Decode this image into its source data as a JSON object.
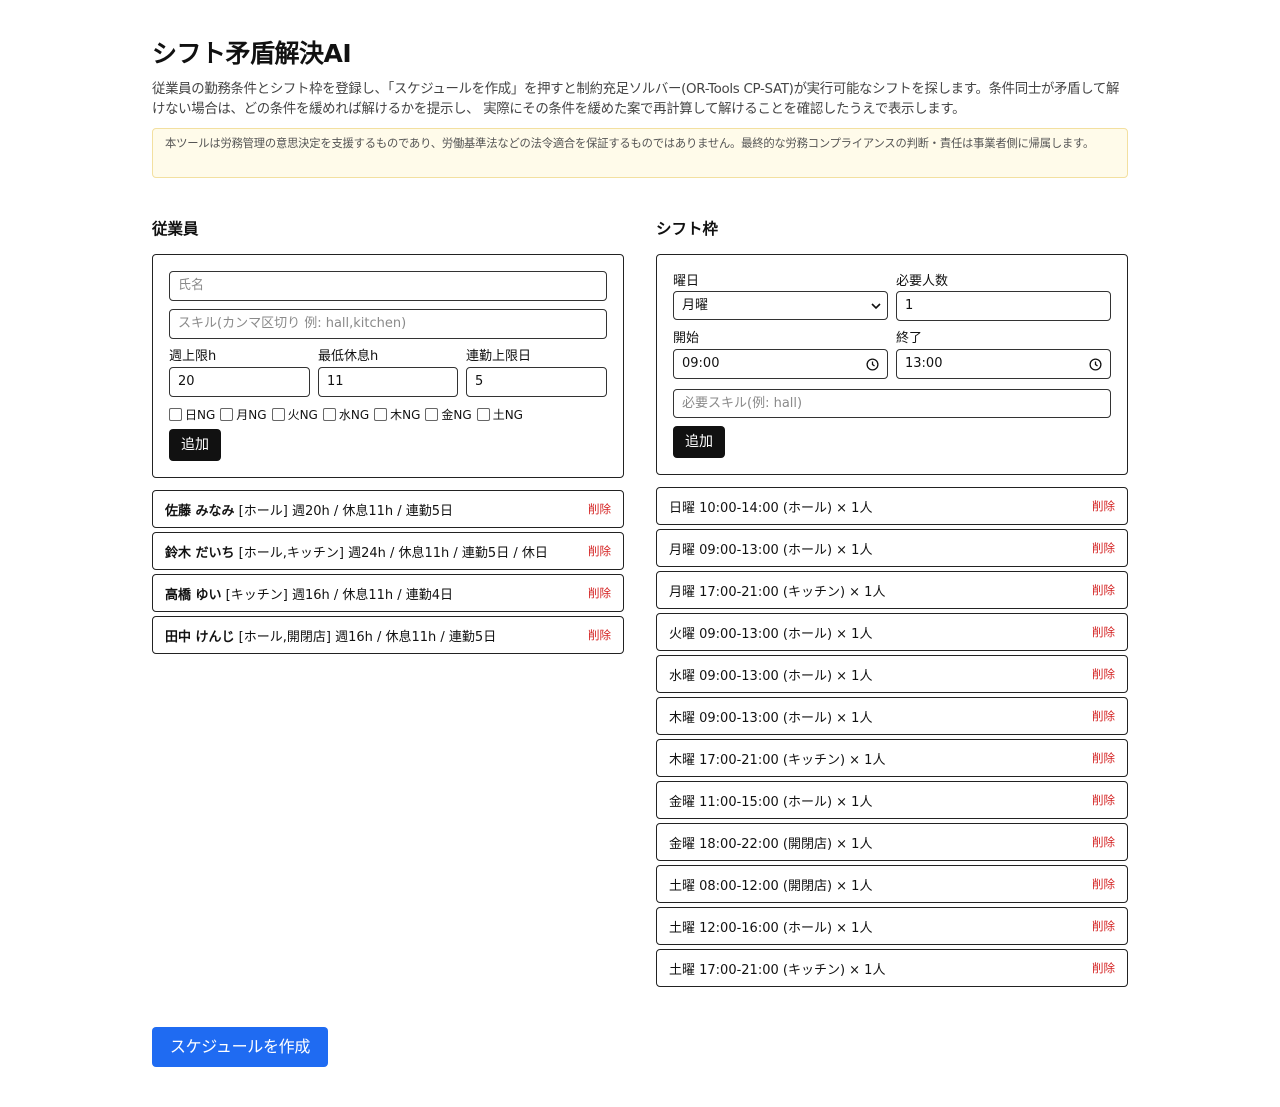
{
  "header": {
    "title": "シフト矛盾解決AI",
    "description": "従業員の勤務条件とシフト枠を登録し、「スケジュールを作成」を押すと制約充足ソルバー(OR-Tools CP-SAT)が実行可能なシフトを探します。条件同士が矛盾して解けない場合は、どの条件を緩めれば解けるかを提示し、 実際にその条件を緩めた案で再計算して解けることを確認したうえで表示します。",
    "notice": "本ツールは労務管理の意思決定を支援するものであり、労働基準法などの法令適合を保証するものではありません。最終的な労務コンプライアンスの判断・責任は事業者側に帰属します。"
  },
  "employees": {
    "section_title": "従業員",
    "form": {
      "name_placeholder": "氏名",
      "skills_placeholder": "スキル(カンマ区切り 例: hall,kitchen)",
      "weekly_limit_label": "週上限h",
      "weekly_limit_value": "20",
      "min_rest_label": "最低休息h",
      "min_rest_value": "11",
      "consecutive_label": "連勤上限日",
      "consecutive_value": "5",
      "ng_days": [
        "日NG",
        "月NG",
        "火NG",
        "水NG",
        "木NG",
        "金NG",
        "土NG"
      ],
      "add_label": "追加"
    },
    "list": [
      {
        "name": "佐藤 みなみ",
        "detail": " [ホール] 週20h / 休息11h / 連勤5日"
      },
      {
        "name": "鈴木 だいち",
        "detail": " [ホール,キッチン] 週24h / 休息11h / 連勤5日 / 休日"
      },
      {
        "name": "高橋 ゆい",
        "detail": " [キッチン] 週16h / 休息11h / 連勤4日"
      },
      {
        "name": "田中 けんじ",
        "detail": " [ホール,開閉店] 週16h / 休息11h / 連勤5日"
      }
    ],
    "delete_label": "削除"
  },
  "shifts": {
    "section_title": "シフト枠",
    "form": {
      "day_label": "曜日",
      "day_value": "月曜",
      "required_label": "必要人数",
      "required_value": "1",
      "start_label": "開始",
      "start_value": "09:00",
      "end_label": "終了",
      "end_value": "13:00",
      "skill_placeholder": "必要スキル(例: hall)",
      "add_label": "追加"
    },
    "list": [
      "日曜 10:00-14:00 (ホール) × 1人",
      "月曜 09:00-13:00 (ホール) × 1人",
      "月曜 17:00-21:00 (キッチン) × 1人",
      "火曜 09:00-13:00 (ホール) × 1人",
      "水曜 09:00-13:00 (ホール) × 1人",
      "木曜 09:00-13:00 (ホール) × 1人",
      "木曜 17:00-21:00 (キッチン) × 1人",
      "金曜 11:00-15:00 (ホール) × 1人",
      "金曜 18:00-22:00 (開閉店) × 1人",
      "土曜 08:00-12:00 (開閉店) × 1人",
      "土曜 12:00-16:00 (ホール) × 1人",
      "土曜 17:00-21:00 (キッチン) × 1人"
    ],
    "delete_label": "削除"
  },
  "actions": {
    "create_schedule_label": "スケジュールを作成"
  },
  "colors": {
    "primary": "#1f6bf2",
    "delete": "#d42020",
    "notice_bg": "#fffbea"
  }
}
